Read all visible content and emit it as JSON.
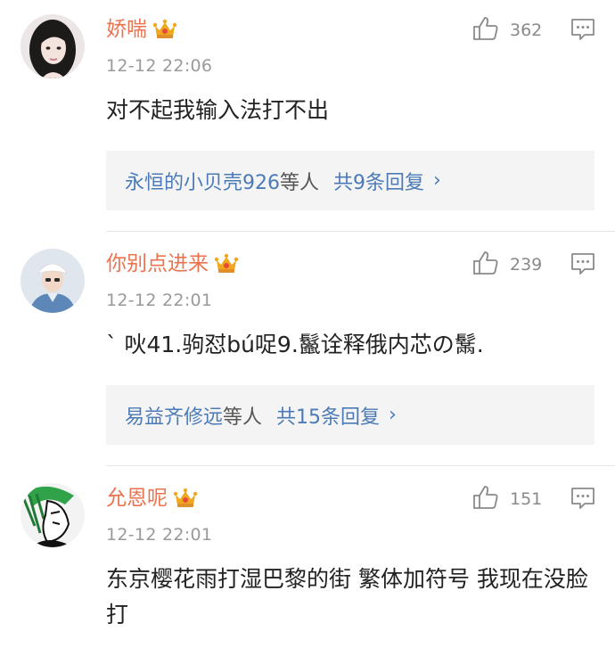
{
  "comments": [
    {
      "username": "娇喘",
      "time": "12-12 22:06",
      "likes": "362",
      "content": "对不起我输入法打不出",
      "replies": {
        "names": "永恒的小贝壳926",
        "etc": "等人",
        "total": "共9条回复",
        "chevron": "›"
      }
    },
    {
      "username": "你别点进来",
      "time": "12-12 22:01",
      "likes": "239",
      "content": "ˋ 吙41.驹怼bú哫9.鬣诠释俄内芯の鬗.",
      "replies": {
        "names": "易益齐修远",
        "etc": "等人",
        "total": "共15条回复",
        "chevron": "›"
      }
    },
    {
      "username": "允恩呢",
      "time": "12-12 22:01",
      "likes": "151",
      "content": "东京樱花雨打湿巴黎的街 繁体加符号 我现在没脸打"
    }
  ],
  "colors": {
    "username": "#eb7350",
    "link": "#4b7bb7",
    "crown": "#f0a81e",
    "replyBox": "#f4f4f4"
  },
  "icons": [
    "vip-crown-icon",
    "thumbs-up-icon",
    "comment-reply-icon",
    "chevron-right-icon"
  ]
}
